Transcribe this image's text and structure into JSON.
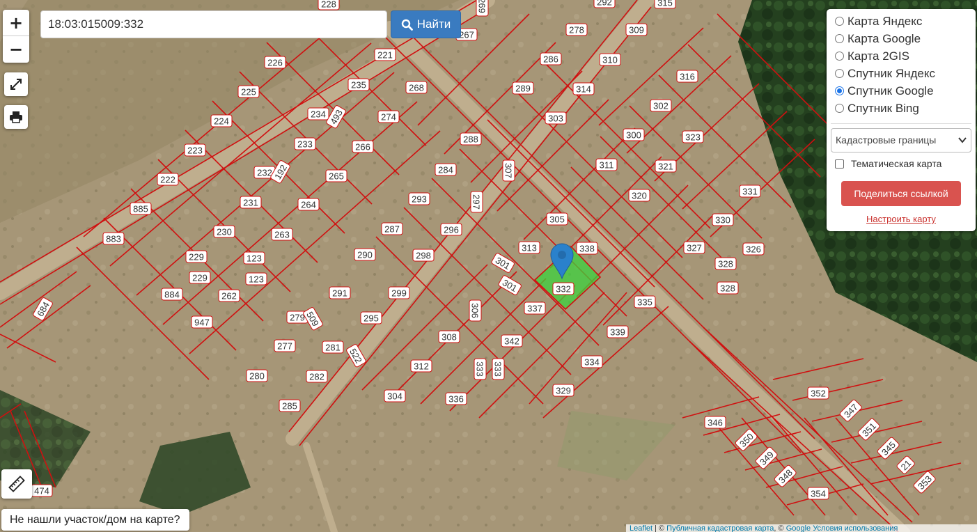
{
  "search": {
    "value": "18:03:015009:332",
    "button_label": "Найти"
  },
  "zoom": {
    "in_label": "+",
    "out_label": "−"
  },
  "layers": [
    {
      "label": "Карта Яндекс",
      "selected": false
    },
    {
      "label": "Карта Google",
      "selected": false
    },
    {
      "label": "Карта 2GIS",
      "selected": false
    },
    {
      "label": "Спутник Яндекс",
      "selected": false
    },
    {
      "label": "Спутник Google",
      "selected": true
    },
    {
      "label": "Спутник Bing",
      "selected": false
    }
  ],
  "panel": {
    "overlay_select": "Кадастровые границы",
    "thematic_label": "Тематическая карта",
    "share_label": "Поделиться ссылкой",
    "configure_label": "Настроить карту"
  },
  "not_found_label": "Не нашли участок/дом на карте?",
  "attribution": {
    "leaflet": "Leaflet",
    "sep1": " | © ",
    "cadastre": "Публичная кадастровая карта",
    "sep2": ", © ",
    "google": "Google",
    "sep3": " ",
    "terms": "Условия использования"
  },
  "parcels": [
    {
      "id": "226"
    },
    {
      "id": "225"
    },
    {
      "id": "224"
    },
    {
      "id": "223"
    },
    {
      "id": "222"
    },
    {
      "id": "885"
    },
    {
      "id": "883"
    },
    {
      "id": "221"
    },
    {
      "id": "235"
    },
    {
      "id": "268"
    },
    {
      "id": "274"
    },
    {
      "id": "234"
    },
    {
      "id": "493"
    },
    {
      "id": "266"
    },
    {
      "id": "233"
    },
    {
      "id": "232"
    },
    {
      "id": "192"
    },
    {
      "id": "265"
    },
    {
      "id": "231"
    },
    {
      "id": "264"
    },
    {
      "id": "230"
    },
    {
      "id": "263"
    },
    {
      "id": "229"
    },
    {
      "id": "123"
    },
    {
      "id": "229"
    },
    {
      "id": "123"
    },
    {
      "id": "884"
    },
    {
      "id": "262"
    },
    {
      "id": "947"
    },
    {
      "id": "684"
    },
    {
      "id": "228"
    },
    {
      "id": "267"
    },
    {
      "id": "269"
    },
    {
      "id": "278"
    },
    {
      "id": "292"
    },
    {
      "id": "309"
    },
    {
      "id": "315"
    },
    {
      "id": "286"
    },
    {
      "id": "310"
    },
    {
      "id": "316"
    },
    {
      "id": "289"
    },
    {
      "id": "314"
    },
    {
      "id": "303"
    },
    {
      "id": "302"
    },
    {
      "id": "300"
    },
    {
      "id": "323"
    },
    {
      "id": "311"
    },
    {
      "id": "321"
    },
    {
      "id": "320"
    },
    {
      "id": "331"
    },
    {
      "id": "330"
    },
    {
      "id": "327"
    },
    {
      "id": "326"
    },
    {
      "id": "328"
    },
    {
      "id": "328"
    },
    {
      "id": "288"
    },
    {
      "id": "284"
    },
    {
      "id": "307"
    },
    {
      "id": "293"
    },
    {
      "id": "297"
    },
    {
      "id": "287"
    },
    {
      "id": "296"
    },
    {
      "id": "305"
    },
    {
      "id": "313"
    },
    {
      "id": "338"
    },
    {
      "id": "290"
    },
    {
      "id": "298"
    },
    {
      "id": "301"
    },
    {
      "id": "301"
    },
    {
      "id": "332"
    },
    {
      "id": "291"
    },
    {
      "id": "299"
    },
    {
      "id": "337"
    },
    {
      "id": "335"
    },
    {
      "id": "306"
    },
    {
      "id": "279"
    },
    {
      "id": "509"
    },
    {
      "id": "295"
    },
    {
      "id": "308"
    },
    {
      "id": "342"
    },
    {
      "id": "339"
    },
    {
      "id": "277"
    },
    {
      "id": "281"
    },
    {
      "id": "522"
    },
    {
      "id": "312"
    },
    {
      "id": "333"
    },
    {
      "id": "333"
    },
    {
      "id": "334"
    },
    {
      "id": "280"
    },
    {
      "id": "282"
    },
    {
      "id": "304"
    },
    {
      "id": "336"
    },
    {
      "id": "329"
    },
    {
      "id": "285"
    },
    {
      "id": "352"
    },
    {
      "id": "347"
    },
    {
      "id": "346"
    },
    {
      "id": "351"
    },
    {
      "id": "350"
    },
    {
      "id": "345"
    },
    {
      "id": "349"
    },
    {
      "id": "21"
    },
    {
      "id": "348"
    },
    {
      "id": "353"
    },
    {
      "id": "354"
    },
    {
      "id": "474"
    }
  ],
  "selected_parcel": "332",
  "colors": {
    "boundary": "#d01010",
    "selected_fill": "#3cd23c",
    "marker": "#2a81cb",
    "search_button": "#3a7bc0",
    "share_button": "#d9534f"
  }
}
